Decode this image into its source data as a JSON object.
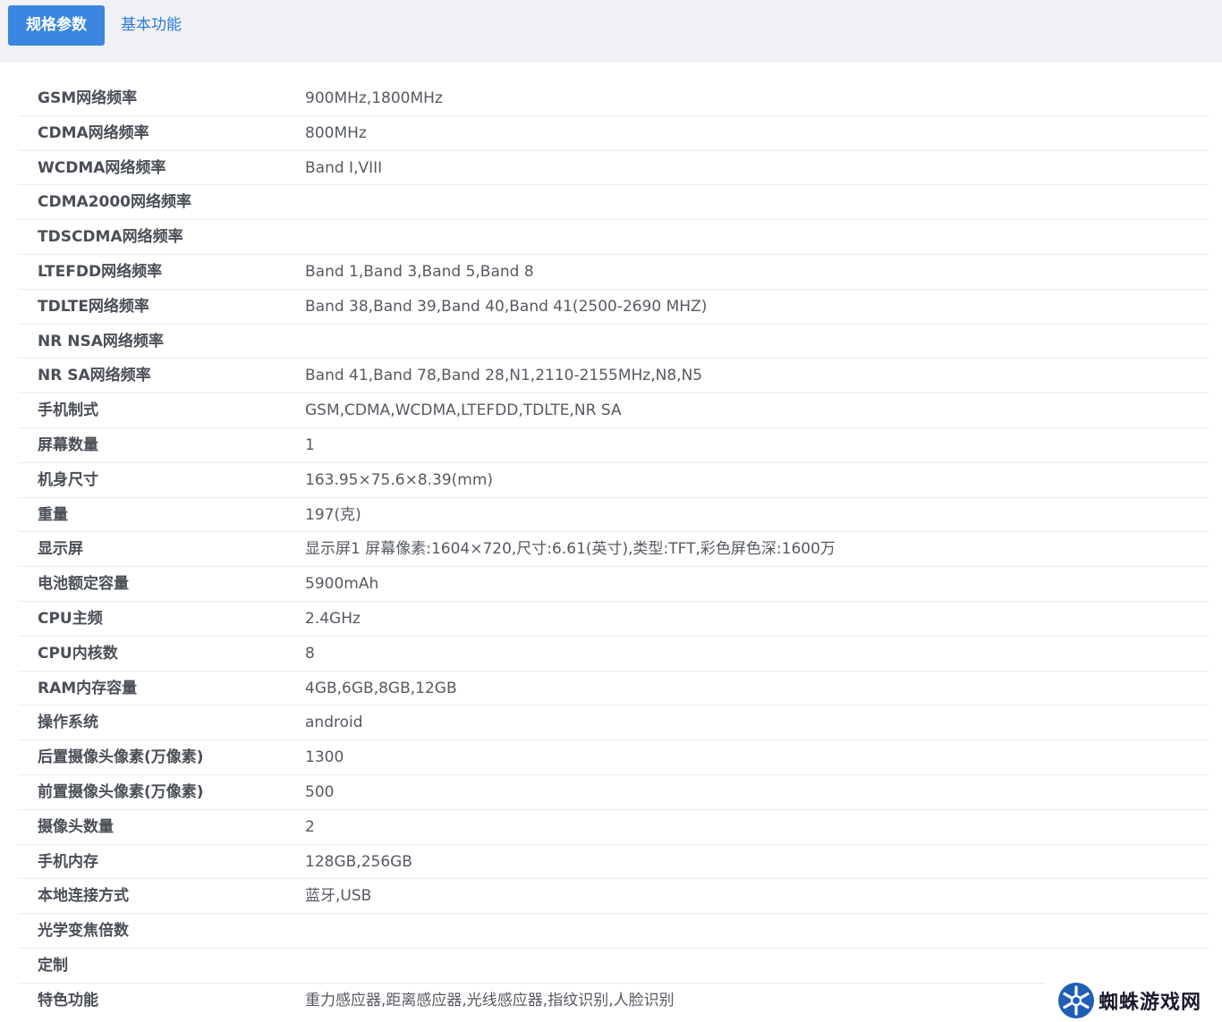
{
  "tabs": [
    {
      "label": "规格参数",
      "active": true
    },
    {
      "label": "基本功能",
      "active": false
    }
  ],
  "specs": [
    {
      "label": "GSM网络频率",
      "value": "900MHz,1800MHz"
    },
    {
      "label": "CDMA网络频率",
      "value": "800MHz"
    },
    {
      "label": "WCDMA网络频率",
      "value": "Band Ⅰ,VIII"
    },
    {
      "label": "CDMA2000网络频率",
      "value": ""
    },
    {
      "label": "TDSCDMA网络频率",
      "value": ""
    },
    {
      "label": "LTEFDD网络频率",
      "value": "Band 1,Band 3,Band 5,Band 8"
    },
    {
      "label": "TDLTE网络频率",
      "value": "Band 38,Band 39,Band 40,Band 41(2500-2690 MHZ)"
    },
    {
      "label": "NR NSA网络频率",
      "value": ""
    },
    {
      "label": "NR SA网络频率",
      "value": "Band 41,Band 78,Band 28,N1,2110-2155MHz,N8,N5"
    },
    {
      "label": "手机制式",
      "value": "GSM,CDMA,WCDMA,LTEFDD,TDLTE,NR SA"
    },
    {
      "label": "屏幕数量",
      "value": "1"
    },
    {
      "label": "机身尺寸",
      "value": "163.95×75.6×8.39(mm)"
    },
    {
      "label": "重量",
      "value": "197(克)"
    },
    {
      "label": "显示屏",
      "value": "显示屏1 屏幕像素:1604×720,尺寸:6.61(英寸),类型:TFT,彩色屏色深:1600万"
    },
    {
      "label": "电池额定容量",
      "value": "5900mAh"
    },
    {
      "label": "CPU主频",
      "value": "2.4GHz"
    },
    {
      "label": "CPU内核数",
      "value": "8"
    },
    {
      "label": "RAM内存容量",
      "value": "4GB,6GB,8GB,12GB"
    },
    {
      "label": "操作系统",
      "value": "android"
    },
    {
      "label": "后置摄像头像素(万像素)",
      "value": "1300"
    },
    {
      "label": "前置摄像头像素(万像素)",
      "value": "500"
    },
    {
      "label": "摄像头数量",
      "value": "2"
    },
    {
      "label": "手机内存",
      "value": "128GB,256GB"
    },
    {
      "label": "本地连接方式",
      "value": "蓝牙,USB"
    },
    {
      "label": "光学变焦倍数",
      "value": ""
    },
    {
      "label": "定制",
      "value": ""
    },
    {
      "label": "特色功能",
      "value": "重力感应器,距离感应器,光线感应器,指纹识别,人脸识别"
    }
  ],
  "watermark": {
    "text": "蜘蛛游戏网",
    "icon": "spider-logo-icon"
  },
  "colors": {
    "accent": "#3a86e0",
    "tab_bg": "#f0f1f5",
    "link": "#2f7bd8"
  }
}
